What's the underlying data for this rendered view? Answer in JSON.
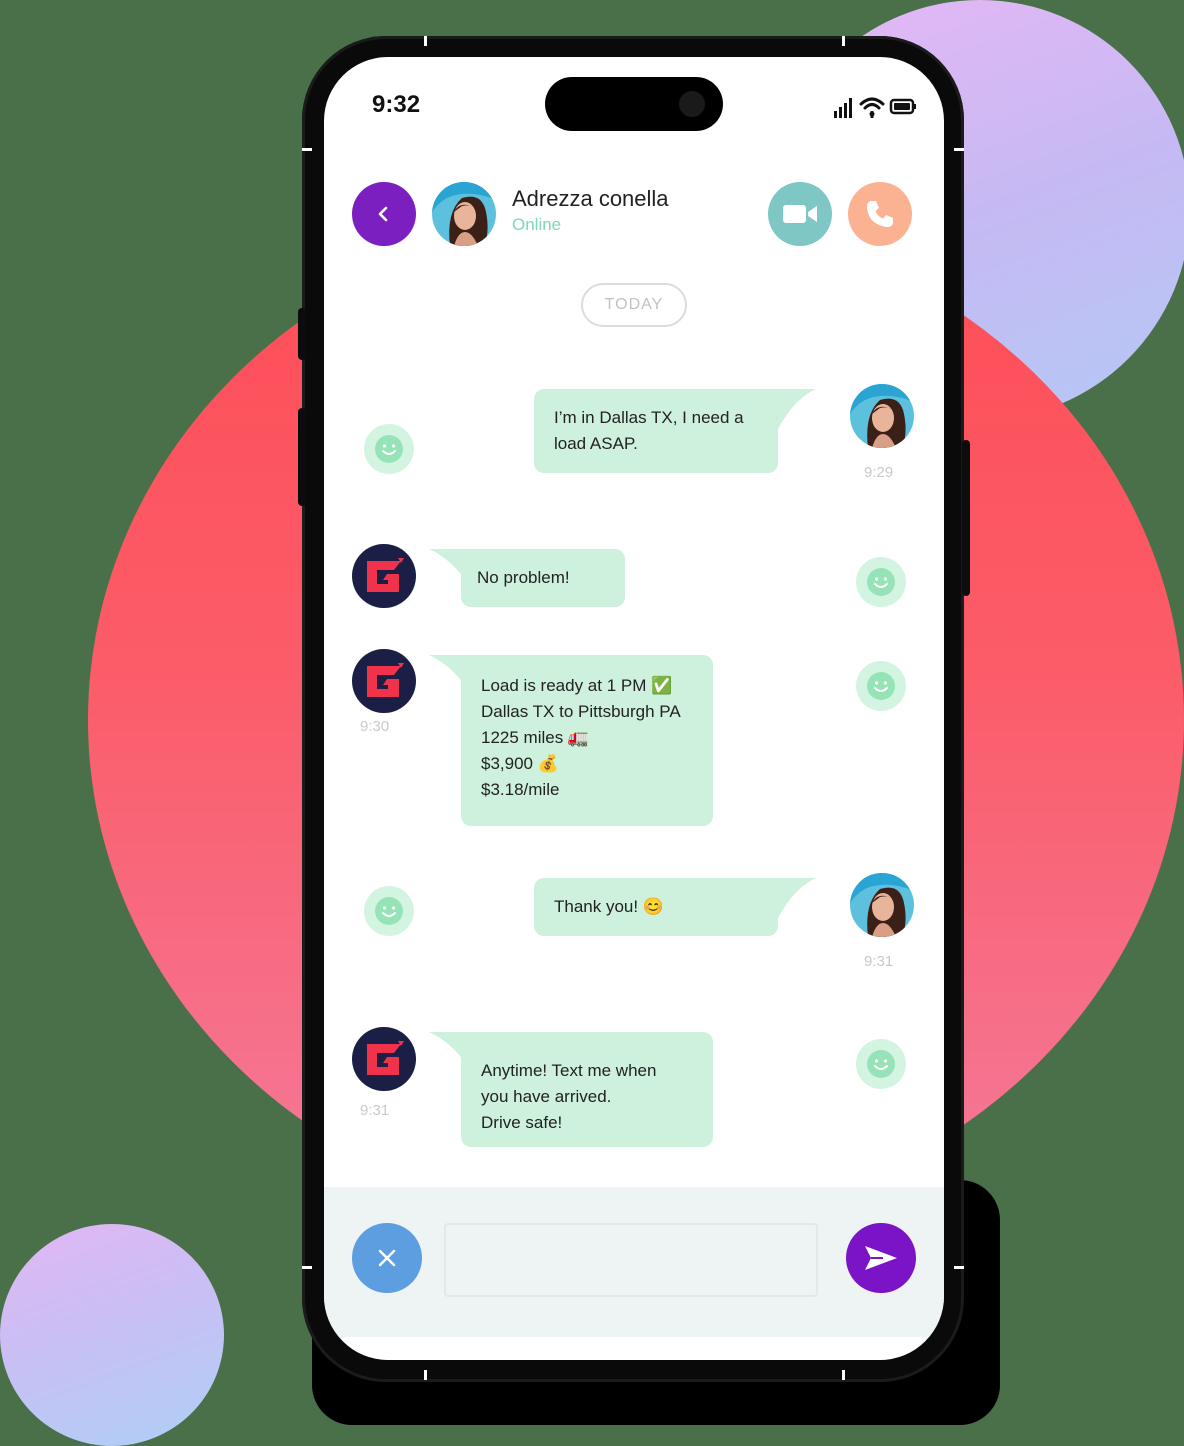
{
  "status_bar": {
    "time": "9:32"
  },
  "header": {
    "contact_name": "Adrezza conella",
    "contact_status": "Online",
    "icons": {
      "back": "chevron-left-icon",
      "video": "video-camera-icon",
      "call": "phone-icon"
    },
    "colors": {
      "back": "#7b1fc1",
      "video": "#7ec7c4",
      "call": "#fbb293",
      "online": "#7fd6b2"
    }
  },
  "divider": {
    "label": "TODAY"
  },
  "messages": [
    {
      "from": "user",
      "lines": [
        "I’m in Dallas TX, I need a",
        "load ASAP."
      ],
      "time": "9:29"
    },
    {
      "from": "dispatcher",
      "lines": [
        "No problem!"
      ],
      "time": ""
    },
    {
      "from": "dispatcher",
      "lines": [
        "Load is ready at 1 PM ✅",
        "Dallas TX to Pittsburgh PA",
        "1225 miles 🚛",
        "$3,900 💰",
        "$3.18/mile"
      ],
      "time": "9:30"
    },
    {
      "from": "user",
      "lines": [
        "Thank you! 😊"
      ],
      "time": "9:31"
    },
    {
      "from": "dispatcher",
      "lines": [
        "Anytime! Text me when",
        "you have arrived.",
        "Drive safe!"
      ],
      "time": "9:31"
    }
  ],
  "composer": {
    "placeholder": "",
    "icons": {
      "cancel": "close-icon",
      "send": "send-icon"
    },
    "colors": {
      "cancel": "#5c9ee0",
      "send": "#7a14c6"
    }
  },
  "colors": {
    "bubble": "#cdf1dc",
    "dispatcher_logo_bg": "#1b1e45",
    "dispatcher_logo_fg": "#f0324a"
  }
}
